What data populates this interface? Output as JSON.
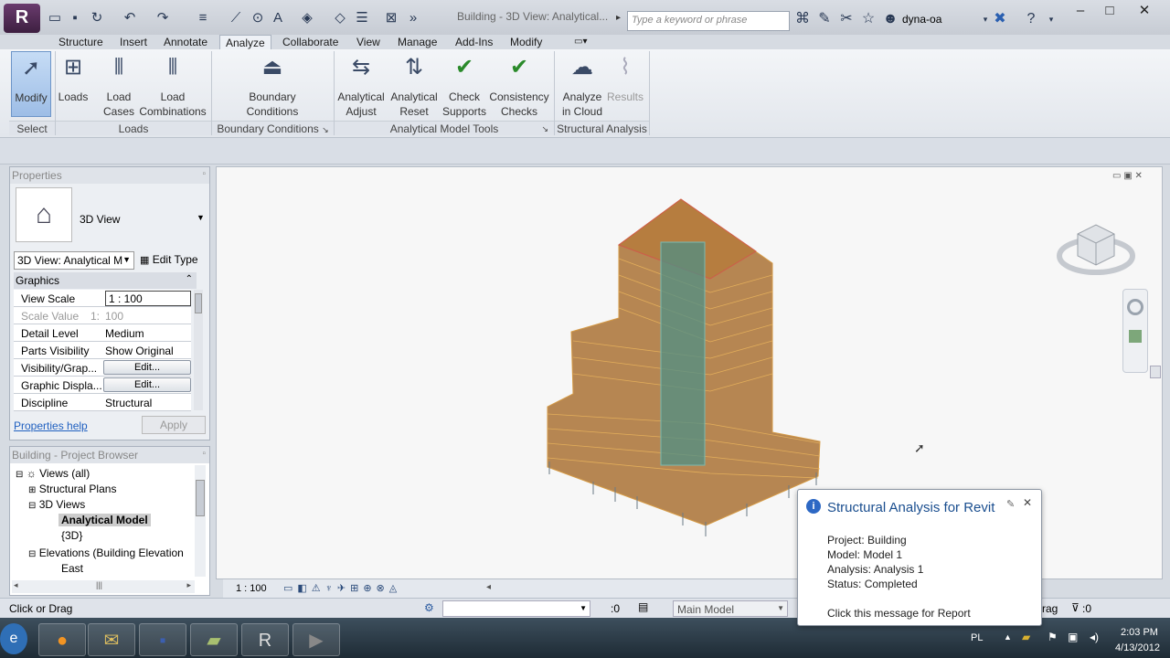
{
  "titlebar": {
    "document_title": "Building - 3D View: Analytical...",
    "search_placeholder": "Type a keyword or phrase",
    "username": "dyna-oa"
  },
  "tabs": [
    "Structure",
    "Insert",
    "Annotate",
    "Analyze",
    "Collaborate",
    "View",
    "Manage",
    "Add-Ins",
    "Modify"
  ],
  "active_tab": "Analyze",
  "ribbon": {
    "modify": "Modify",
    "loads": "Loads",
    "load_cases": [
      "Load",
      "Cases"
    ],
    "load_combinations": [
      "Load",
      "Combinations"
    ],
    "boundary_conditions": [
      "Boundary",
      "Conditions"
    ],
    "analytical_adjust": [
      "Analytical",
      "Adjust"
    ],
    "analytical_reset": [
      "Analytical",
      "Reset"
    ],
    "check_supports": [
      "Check",
      "Supports"
    ],
    "consistency_checks": [
      "Consistency",
      "Checks"
    ],
    "analyze_in_cloud": [
      "Analyze",
      "in Cloud"
    ],
    "results": "Results",
    "panels": {
      "select": "Select",
      "loads": "Loads",
      "boundary": "Boundary Conditions",
      "analytical_tools": "Analytical Model Tools",
      "structural_analysis": "Structural Analysis"
    }
  },
  "properties": {
    "header": "Properties",
    "type_name": "3D View",
    "view_selector": "3D View: Analytical M",
    "edit_type": "Edit Type",
    "group": "Graphics",
    "rows": [
      {
        "key": "View Scale",
        "value": "1 : 100"
      },
      {
        "key": "Scale Value",
        "prefix": "1:",
        "value": "100"
      },
      {
        "key": "Detail Level",
        "value": "Medium"
      },
      {
        "key": "Parts Visibility",
        "value": "Show Original"
      },
      {
        "key": "Visibility/Grap...",
        "value": "Edit..."
      },
      {
        "key": "Graphic Displa...",
        "value": "Edit..."
      },
      {
        "key": "Discipline",
        "value": "Structural"
      }
    ],
    "help_link": "Properties help",
    "apply": "Apply"
  },
  "browser": {
    "header": "Building - Project Browser",
    "nodes": [
      "Views (all)",
      "Structural Plans",
      "3D Views",
      "Analytical Model",
      "{3D}",
      "Elevations (Building Elevation",
      "East"
    ]
  },
  "viewport": {
    "scale": "1 : 100"
  },
  "statusbar": {
    "message": "Click or Drag",
    "selection_count": ":0",
    "model": "Main Model",
    "drag_label": "rag",
    "filter_count": ":0"
  },
  "toast": {
    "title": "Structural Analysis for Revit",
    "project": "Project: Building",
    "model": "Model: Model 1",
    "analysis": "Analysis: Analysis 1",
    "status": "Status: Completed",
    "link": "Click this message for Report"
  },
  "tray": {
    "language": "PL",
    "time": "2:03 PM",
    "date": "4/13/2012"
  },
  "colors": {
    "structure_fill": "#9c5a12",
    "structure_edge": "#e0a040",
    "core_fill": "#3d7b74",
    "accent_blue": "#1a4e8f"
  }
}
